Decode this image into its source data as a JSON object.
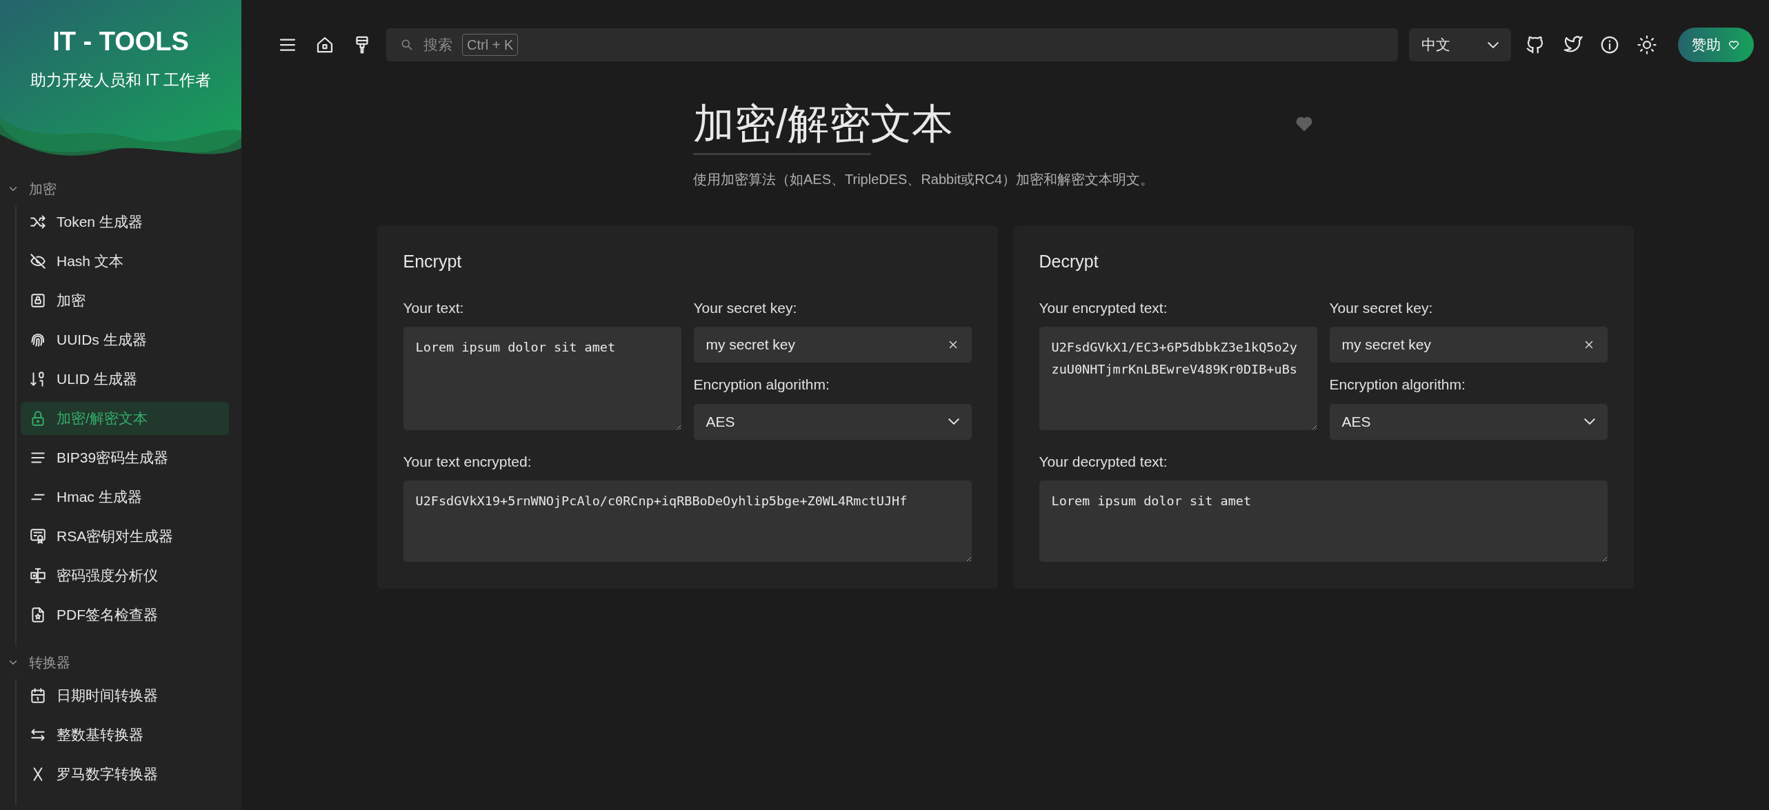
{
  "sidebar": {
    "brand": {
      "title": "IT - TOOLS",
      "subtitle": "助力开发人员和 IT 工作者"
    },
    "groups": [
      {
        "title": "加密",
        "expanded": true,
        "items": [
          {
            "label": "Token 生成器",
            "selected": false
          },
          {
            "label": "Hash 文本",
            "selected": false
          },
          {
            "label": "加密",
            "selected": false
          },
          {
            "label": "UUIDs 生成器",
            "selected": false
          },
          {
            "label": "ULID 生成器",
            "selected": false
          },
          {
            "label": "加密/解密文本",
            "selected": true
          },
          {
            "label": "BIP39密码生成器",
            "selected": false
          },
          {
            "label": "Hmac 生成器",
            "selected": false
          },
          {
            "label": "RSA密钥对生成器",
            "selected": false
          },
          {
            "label": "密码强度分析仪",
            "selected": false
          },
          {
            "label": "PDF签名检查器",
            "selected": false
          }
        ]
      },
      {
        "title": "转换器",
        "expanded": true,
        "items": [
          {
            "label": "日期时间转换器",
            "selected": false
          },
          {
            "label": "整数基转换器",
            "selected": false
          },
          {
            "label": "罗马数字转换器",
            "selected": false
          }
        ]
      }
    ]
  },
  "header": {
    "search": {
      "placeholder": "搜索",
      "shortcut": "Ctrl + K"
    },
    "language": "中文",
    "sponsor": "赞助"
  },
  "page": {
    "title": "加密/解密文本",
    "favorite": false,
    "description": "使用加密算法（如AES、TripleDES、Rabbit或RC4）加密和解密文本明文。"
  },
  "cards": [
    {
      "title": "Encrypt",
      "input_label": "Your text:",
      "input_value": "Lorem ipsum dolor sit amet",
      "key_label": "Your secret key:",
      "key_value": "my secret key",
      "algorithm_label": "Encryption algorithm:",
      "algorithm": "AES",
      "output_label": "Your text encrypted:",
      "output_value": "U2FsdGVkX19+5rnWNOjPcAlo/c0RCnp+iqRBBoDeOyhlip5bge+Z0WL4RmctUJHf"
    },
    {
      "title": "Decrypt",
      "input_label": "Your encrypted text:",
      "input_value": "U2FsdGVkX1/EC3+6P5dbbkZ3e1kQ5o2yzuU0NHTjmrKnLBEwreV489Kr0DIB+uBs",
      "key_label": "Your secret key:",
      "key_value": "my secret key",
      "algorithm_label": "Encryption algorithm:",
      "algorithm": "AES",
      "output_label": "Your decrypted text:",
      "output_value": "Lorem ipsum dolor sit amet"
    }
  ]
}
